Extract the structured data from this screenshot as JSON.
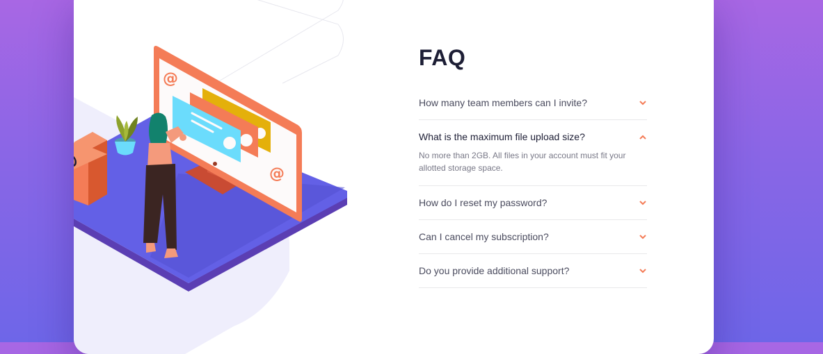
{
  "faq": {
    "title": "FAQ",
    "items": [
      {
        "question": "How many team members can I invite?",
        "open": false
      },
      {
        "question": "What is the maximum file upload size?",
        "open": true,
        "answer": "No more than 2GB. All files in your account must fit your allotted storage space."
      },
      {
        "question": "How do I reset my password?",
        "open": false
      },
      {
        "question": "Can I cancel my subscription?",
        "open": false
      },
      {
        "question": "Do you provide additional support?",
        "open": false
      }
    ]
  },
  "icons": {
    "chevron_down": "chevron-down-icon",
    "chevron_up": "chevron-up-icon"
  },
  "colors": {
    "accent": "#f47c57",
    "title": "#1d1e35",
    "question": "#4a4b5e",
    "answer": "#787887",
    "background_top": "#a867e4",
    "background_bottom": "#6e66e8"
  }
}
